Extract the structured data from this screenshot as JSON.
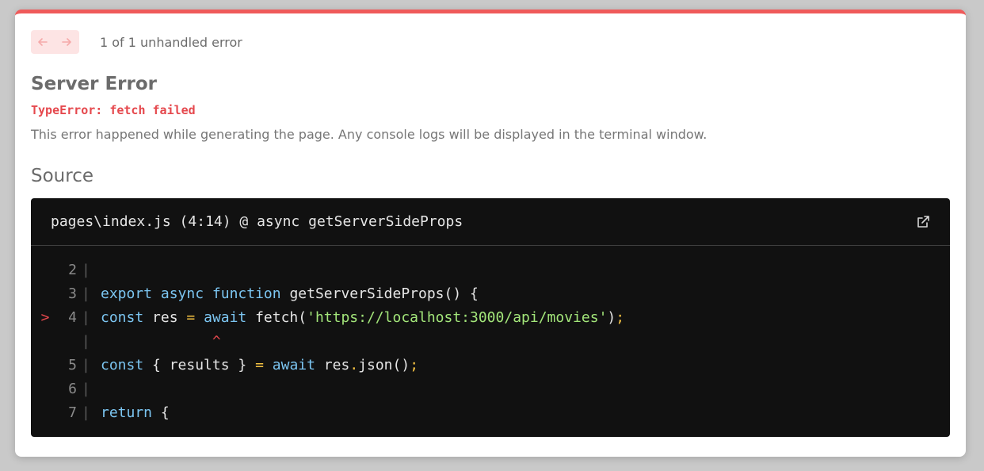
{
  "nav": {
    "prev_icon": "arrow-left-icon",
    "next_icon": "arrow-right-icon",
    "counter_text": "1 of 1 unhandled error"
  },
  "error": {
    "title": "Server Error",
    "message": "TypeError: fetch failed",
    "description": "This error happened while generating the page. Any console logs will be displayed in the terminal window."
  },
  "source": {
    "heading": "Source",
    "file_label": "pages\\index.js (4:14) @ async getServerSideProps",
    "open_icon": "external-link-icon",
    "lines": {
      "l2": {
        "num": "2"
      },
      "l3": {
        "num": "3",
        "kw1": "export",
        "kw2": "async",
        "kw3": "function",
        "rest": " getServerSideProps() {"
      },
      "l4": {
        "num": "4",
        "marker": ">",
        "kw1": "const",
        "mid1": " res ",
        "eq": "=",
        "sp": " ",
        "kw2": "await",
        "mid2": " fetch(",
        "str": "'https://localhost:3000/api/movies'",
        "tail": ")",
        "semi": ";"
      },
      "caret": {
        "char": "^"
      },
      "l5": {
        "num": "5",
        "kw1": "const",
        "mid1": " { results } ",
        "eq": "=",
        "sp": " ",
        "kw2": "await",
        "mid2": " res",
        "dot": ".",
        "mid3": "json()",
        "semi": ";"
      },
      "l6": {
        "num": "6"
      },
      "l7": {
        "num": "7",
        "kw1": "return",
        "rest": " {"
      }
    }
  },
  "colors": {
    "accent": "#ef5a5a",
    "error_text": "#e5484d",
    "code_bg": "#111111",
    "keyword": "#7cc6f2",
    "string": "#a3e67a"
  }
}
